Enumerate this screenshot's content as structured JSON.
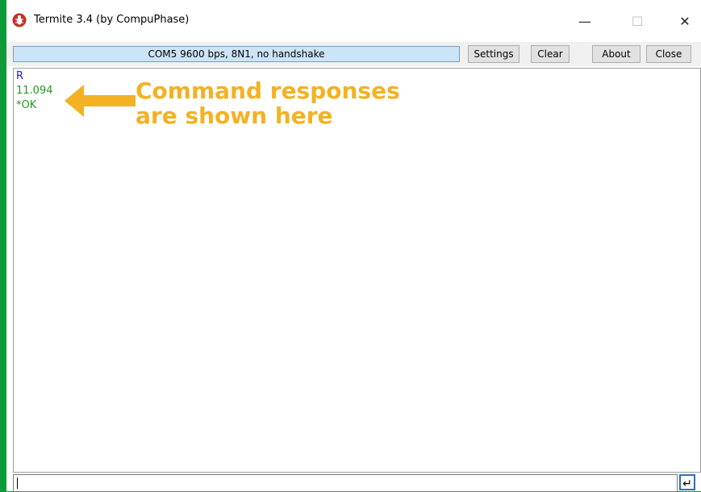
{
  "window": {
    "title": "Termite 3.4 (by CompuPhase)"
  },
  "toolbar": {
    "status": "COM5 9600 bps, 8N1, no handshake",
    "settings_label": "Settings",
    "clear_label": "Clear",
    "about_label": "About",
    "close_label": "Close"
  },
  "terminal": {
    "lines": [
      {
        "text": "R",
        "color": "#1a1ae6"
      },
      {
        "text": "11.094",
        "color": "#1f9a1f"
      },
      {
        "text": "*OK",
        "color": "#1f9a1f"
      }
    ]
  },
  "annotation": {
    "line1": "Command responses",
    "line2": "are shown here",
    "color": "#f2b223"
  },
  "input": {
    "value": ""
  },
  "icons": {
    "app": "termite-bug-icon",
    "send": "enter-icon"
  }
}
